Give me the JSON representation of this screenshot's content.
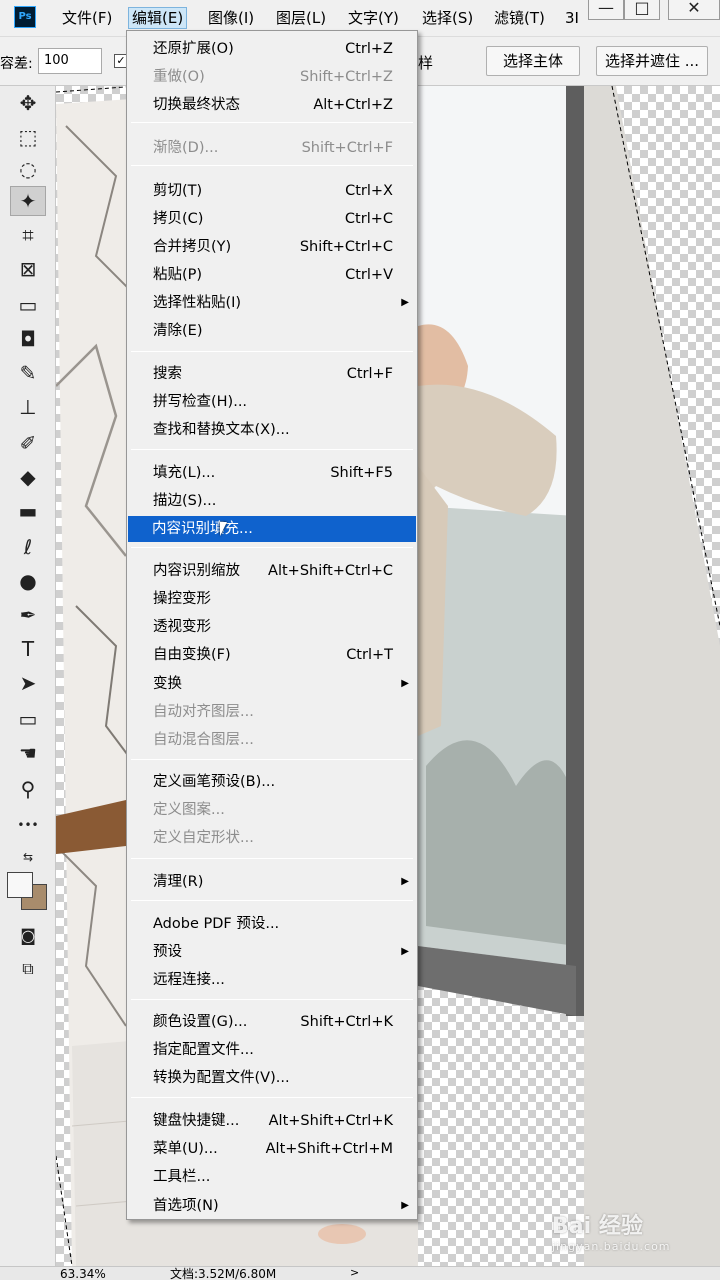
{
  "app": {
    "logo": "Ps"
  },
  "menubar": {
    "items": [
      {
        "label": "文件(F)"
      },
      {
        "label": "编辑(E)"
      },
      {
        "label": "图像(I)"
      },
      {
        "label": "图层(L)"
      },
      {
        "label": "文字(Y)"
      },
      {
        "label": "选择(S)"
      },
      {
        "label": "滤镜(T)"
      },
      {
        "label": "3I"
      }
    ],
    "window_controls": {
      "minimize": "—",
      "maximize": "□",
      "close": "✕"
    }
  },
  "options_bar": {
    "tolerance_label": "容差:",
    "tolerance_value": "100",
    "checkbox_checked": true,
    "partial_label": "样",
    "select_subject": "选择主体",
    "select_and_mask": "选择并遮住 ..."
  },
  "toolbar": {
    "tools": [
      {
        "name": "move-tool",
        "icon": "✥"
      },
      {
        "name": "marquee-tool",
        "icon": "⬚"
      },
      {
        "name": "lasso-tool",
        "icon": "◌"
      },
      {
        "name": "magic-wand-tool",
        "icon": "✦",
        "selected": true
      },
      {
        "name": "crop-tool",
        "icon": "⌗"
      },
      {
        "name": "frame-tool",
        "icon": "⊠"
      },
      {
        "name": "ruler-tool",
        "icon": "▭"
      },
      {
        "name": "patch-tool",
        "icon": "◘"
      },
      {
        "name": "brush-tool",
        "icon": "✎"
      },
      {
        "name": "stamp-tool",
        "icon": "⊥"
      },
      {
        "name": "history-brush-tool",
        "icon": "✐"
      },
      {
        "name": "eraser-tool",
        "icon": "◆"
      },
      {
        "name": "gradient-tool",
        "icon": "▬"
      },
      {
        "name": "blur-tool",
        "icon": "ℓ"
      },
      {
        "name": "dodge-tool",
        "icon": "●"
      },
      {
        "name": "pen-tool",
        "icon": "✒"
      },
      {
        "name": "type-tool",
        "icon": "T"
      },
      {
        "name": "path-selection-tool",
        "icon": "➤"
      },
      {
        "name": "rectangle-tool",
        "icon": "▭"
      },
      {
        "name": "hand-tool",
        "icon": "☚"
      },
      {
        "name": "zoom-tool",
        "icon": "⚲"
      },
      {
        "name": "more-tools",
        "icon": "•••"
      }
    ],
    "colors": {
      "foreground": "#f8f8f8",
      "background": "#a88c6c"
    },
    "quick_mask_icon": "quick-mask-icon",
    "screen_mode_icon": "screen-mode-icon"
  },
  "edit_menu": {
    "items": [
      {
        "label": "还原扩展(O)",
        "shortcut": "Ctrl+Z",
        "disabled": false
      },
      {
        "label": "重做(O)",
        "shortcut": "Shift+Ctrl+Z",
        "disabled": true
      },
      {
        "label": "切换最终状态",
        "shortcut": "Alt+Ctrl+Z",
        "disabled": false
      },
      {
        "label": "渐隐(D)...",
        "shortcut": "Shift+Ctrl+F",
        "disabled": true
      },
      {
        "label": "剪切(T)",
        "shortcut": "Ctrl+X",
        "disabled": false
      },
      {
        "label": "拷贝(C)",
        "shortcut": "Ctrl+C",
        "disabled": false
      },
      {
        "label": "合并拷贝(Y)",
        "shortcut": "Shift+Ctrl+C",
        "disabled": false
      },
      {
        "label": "粘贴(P)",
        "shortcut": "Ctrl+V",
        "disabled": false
      },
      {
        "label": "选择性粘贴(I)",
        "shortcut": "",
        "submenu": true
      },
      {
        "label": "清除(E)",
        "shortcut": "",
        "disabled": false
      },
      {
        "label": "搜索",
        "shortcut": "Ctrl+F",
        "disabled": false
      },
      {
        "label": "拼写检查(H)...",
        "shortcut": "",
        "disabled": false
      },
      {
        "label": "查找和替换文本(X)...",
        "shortcut": "",
        "disabled": false
      },
      {
        "label": "填充(L)...",
        "shortcut": "Shift+F5",
        "disabled": false
      },
      {
        "label": "描边(S)...",
        "shortcut": "",
        "disabled": false
      },
      {
        "label": "内容识别填充...",
        "shortcut": "",
        "highlighted": true
      },
      {
        "label": "内容识别缩放",
        "shortcut": "Alt+Shift+Ctrl+C",
        "disabled": false
      },
      {
        "label": "操控变形",
        "shortcut": "",
        "disabled": false
      },
      {
        "label": "透视变形",
        "shortcut": "",
        "disabled": false
      },
      {
        "label": "自由变换(F)",
        "shortcut": "Ctrl+T",
        "disabled": false
      },
      {
        "label": "变换",
        "shortcut": "",
        "submenu": true
      },
      {
        "label": "自动对齐图层...",
        "shortcut": "",
        "disabled": true
      },
      {
        "label": "自动混合图层...",
        "shortcut": "",
        "disabled": true
      },
      {
        "label": "定义画笔预设(B)...",
        "shortcut": "",
        "disabled": false
      },
      {
        "label": "定义图案...",
        "shortcut": "",
        "disabled": true
      },
      {
        "label": "定义自定形状...",
        "shortcut": "",
        "disabled": true
      },
      {
        "label": "清理(R)",
        "shortcut": "",
        "submenu": true
      },
      {
        "label": "Adobe PDF 预设...",
        "shortcut": "",
        "disabled": false
      },
      {
        "label": "预设",
        "shortcut": "",
        "submenu": true
      },
      {
        "label": "远程连接...",
        "shortcut": "",
        "disabled": false
      },
      {
        "label": "颜色设置(G)...",
        "shortcut": "Shift+Ctrl+K",
        "disabled": false
      },
      {
        "label": "指定配置文件...",
        "shortcut": "",
        "disabled": false
      },
      {
        "label": "转换为配置文件(V)...",
        "shortcut": "",
        "disabled": false
      },
      {
        "label": "键盘快捷键...",
        "shortcut": "Alt+Shift+Ctrl+K",
        "disabled": false
      },
      {
        "label": "菜单(U)...",
        "shortcut": "Alt+Shift+Ctrl+M",
        "disabled": false
      },
      {
        "label": "工具栏...",
        "shortcut": "",
        "disabled": false
      },
      {
        "label": "首选项(N)",
        "shortcut": "",
        "submenu": true
      }
    ],
    "submenu_arrow": "▶",
    "highlight_color": "#0f62cd"
  },
  "status_bar": {
    "zoom": "63.34%",
    "doc_info": "文档:3.52M/6.80M",
    "nav_arrow": ">"
  },
  "watermark": {
    "text": "Bai 经验",
    "sub": "jingyan.baidu.com"
  }
}
